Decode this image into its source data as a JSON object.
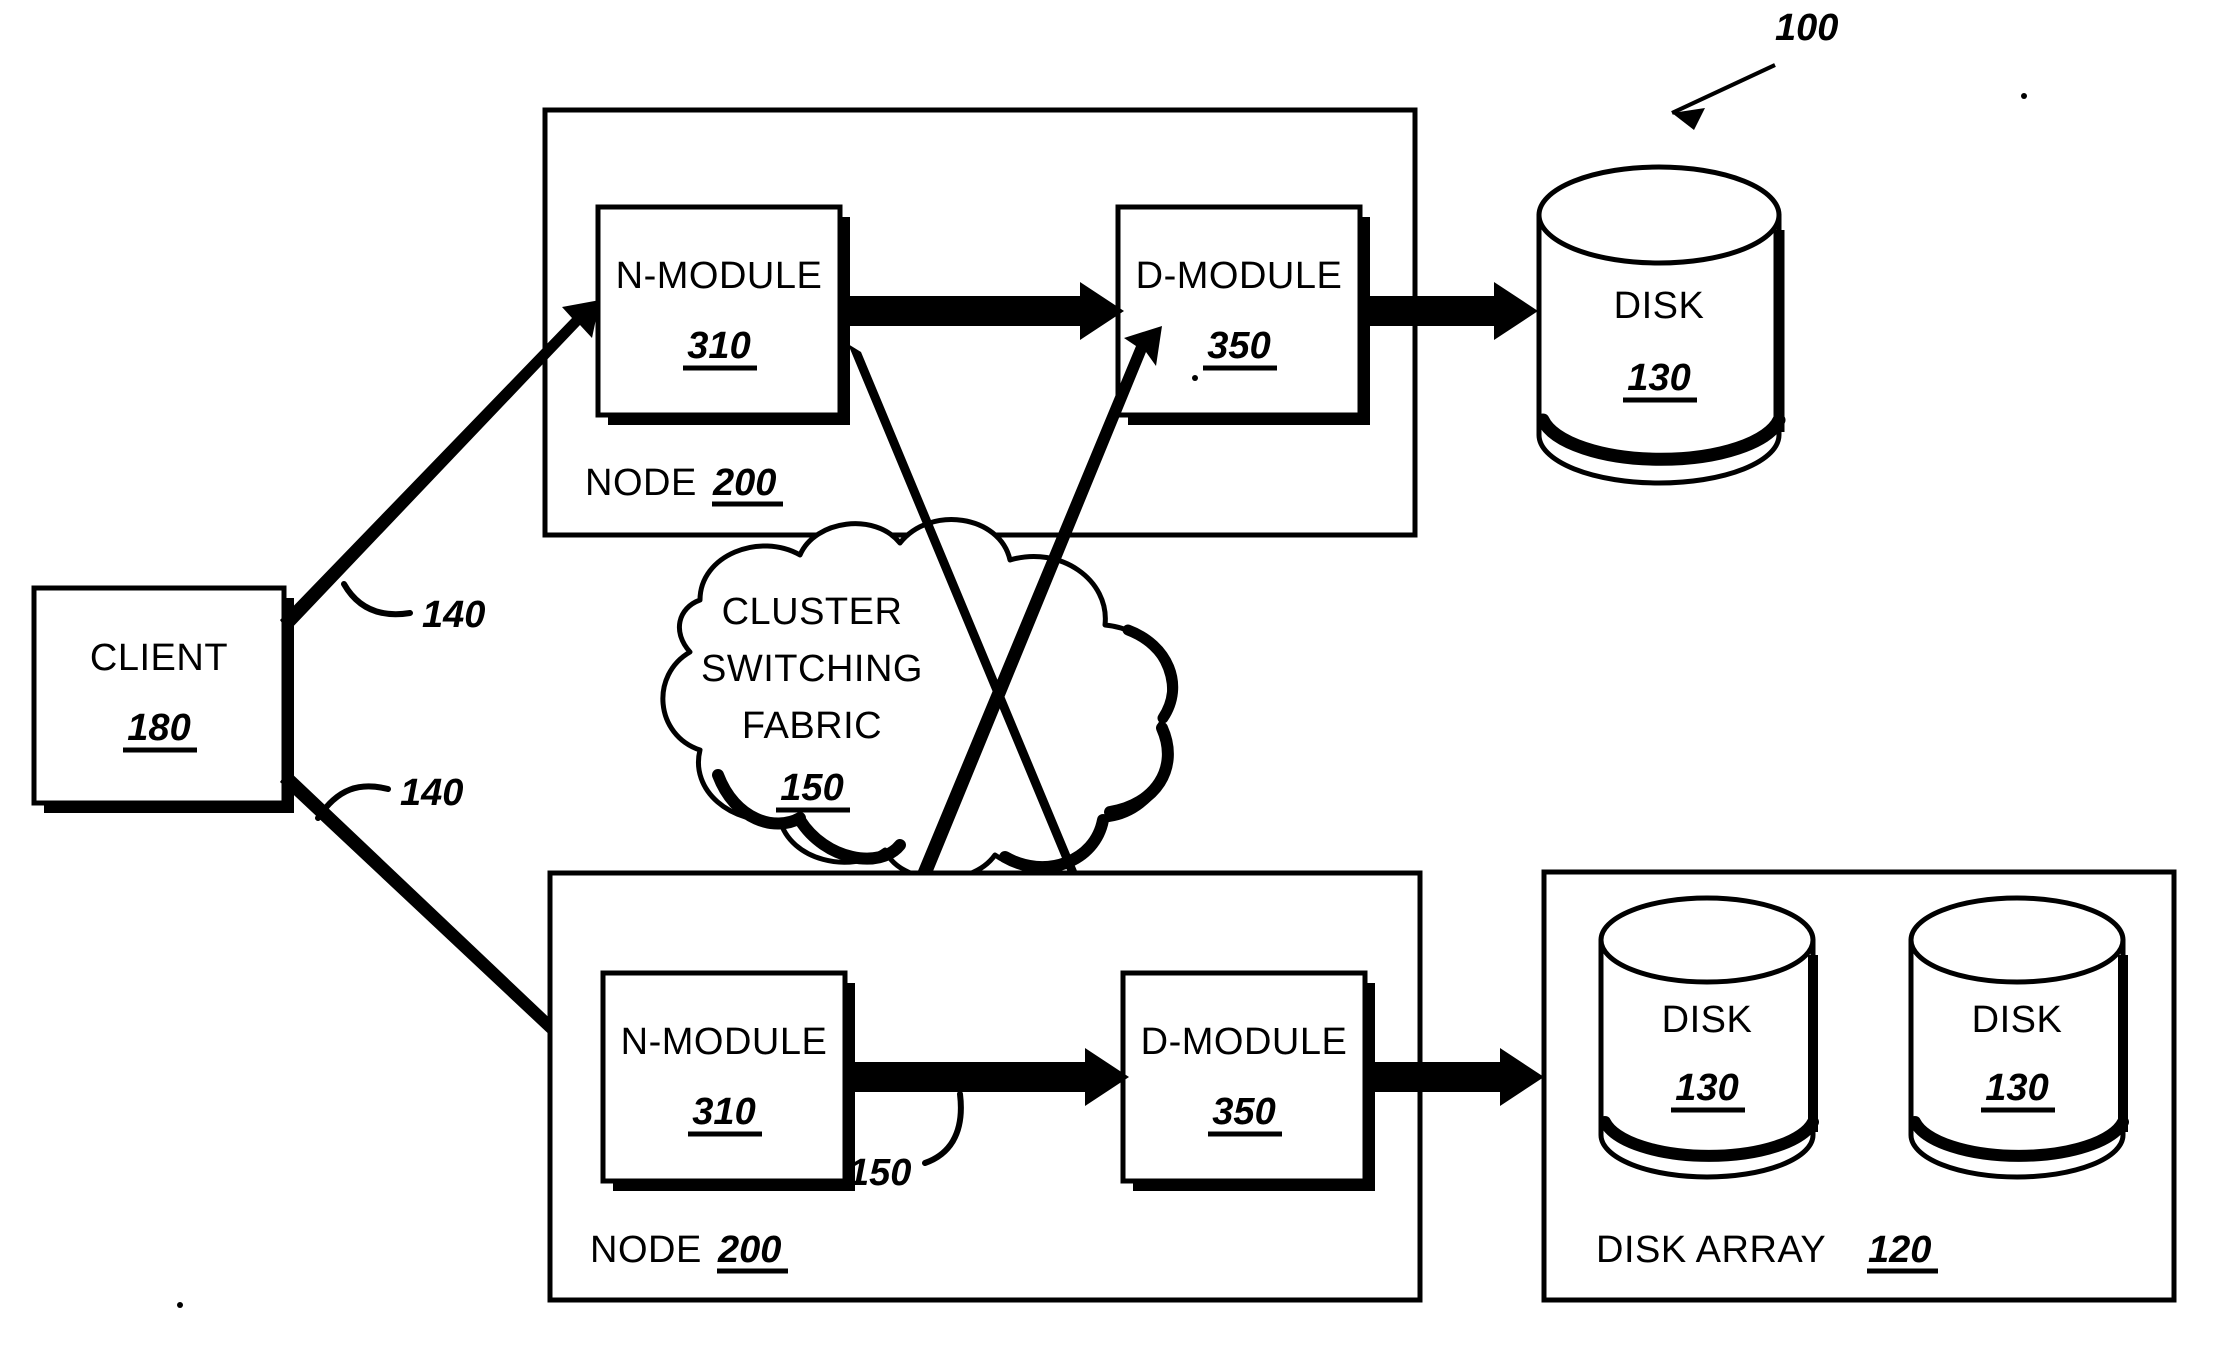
{
  "figure": {
    "reference_numeral": "100",
    "type": "patent-block-diagram"
  },
  "client": {
    "title": "CLIENT",
    "ref": "180"
  },
  "connections": {
    "client_link_upper": "140",
    "client_link_lower": "140",
    "intra_node_link": "150"
  },
  "node_top": {
    "label": "NODE",
    "ref": "200",
    "n_module": {
      "title": "N-MODULE",
      "ref": "310"
    },
    "d_module": {
      "title": "D-MODULE",
      "ref": "350"
    }
  },
  "node_bottom": {
    "label": "NODE",
    "ref": "200",
    "n_module": {
      "title": "N-MODULE",
      "ref": "310"
    },
    "d_module": {
      "title": "D-MODULE",
      "ref": "350"
    }
  },
  "cloud": {
    "line1": "CLUSTER",
    "line2": "SWITCHING",
    "line3": "FABRIC",
    "ref": "150"
  },
  "disk_standalone": {
    "title": "DISK",
    "ref": "130"
  },
  "disk_array": {
    "label": "DISK ARRAY",
    "ref": "120",
    "disks": [
      {
        "title": "DISK",
        "ref": "130"
      },
      {
        "title": "DISK",
        "ref": "130"
      }
    ]
  },
  "colors": {
    "ink": "#000000",
    "paper": "#ffffff"
  }
}
